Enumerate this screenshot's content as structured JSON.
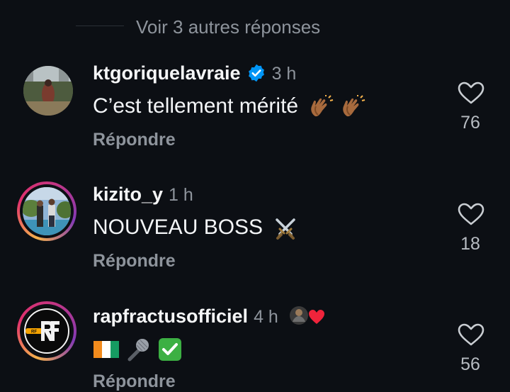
{
  "more_replies": {
    "label": "Voir 3 autres réponses"
  },
  "comments": [
    {
      "username": "ktgoriquelavraie",
      "verified": true,
      "time": "3 h",
      "text": "C’est tellement mérité",
      "emojis": [
        "clapping-hands-emoji",
        "clapping-hands-emoji"
      ],
      "reply_label": "Répondre",
      "likes": "76",
      "icon": "heart-icon"
    },
    {
      "username": "kizito_y",
      "verified": false,
      "time": "1 h",
      "text": "NOUVEAU BOSS",
      "emojis": [
        "crossed-swords-emoji"
      ],
      "reply_label": "Répondre",
      "likes": "18",
      "icon": "heart-icon"
    },
    {
      "username": "rapfractusofficiel",
      "verified": false,
      "time": "4 h",
      "text": "",
      "emojis": [
        "ivory-coast-flag-emoji",
        "microphone-emoji",
        "check-mark-emoji"
      ],
      "reply_label": "Répondre",
      "likes": "56",
      "icon": "heart-icon",
      "avatar_text": "RF"
    }
  ],
  "colors": {
    "background": "#0c0f14",
    "secondary_text": "#8e949c",
    "verified_blue": "#0095f6",
    "story_ring": "#e1306c"
  }
}
